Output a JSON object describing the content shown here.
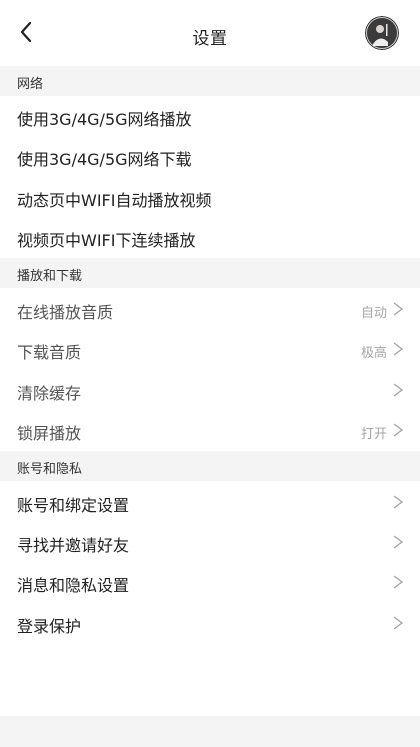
{
  "header": {
    "title": "设置",
    "back_icon": "chevron-left-icon",
    "avatar_icon": "user-avatar"
  },
  "sections": [
    {
      "title": "网络",
      "items": [
        {
          "label": "使用3G/4G/5G网络播放"
        },
        {
          "label": "使用3G/4G/5G网络下载"
        },
        {
          "label": "动态页中WIFI自动播放视频"
        },
        {
          "label": "视频页中WIFI下连续播放"
        }
      ]
    },
    {
      "title": "播放和下载",
      "items": [
        {
          "label": "在线播放音质",
          "value": "自动"
        },
        {
          "label": "下载音质",
          "value": "极高"
        },
        {
          "label": "清除缓存",
          "value": ""
        },
        {
          "label": "锁屏播放",
          "value": "打开"
        }
      ]
    },
    {
      "title": "账号和隐私",
      "items": [
        {
          "label": "账号和绑定设置"
        },
        {
          "label": "寻找并邀请好友"
        },
        {
          "label": "消息和隐私设置"
        },
        {
          "label": "登录保护"
        }
      ]
    }
  ],
  "colors": {
    "section_bg": "#f4f4f4",
    "text": "#222222",
    "muted": "#a6a6a6"
  }
}
